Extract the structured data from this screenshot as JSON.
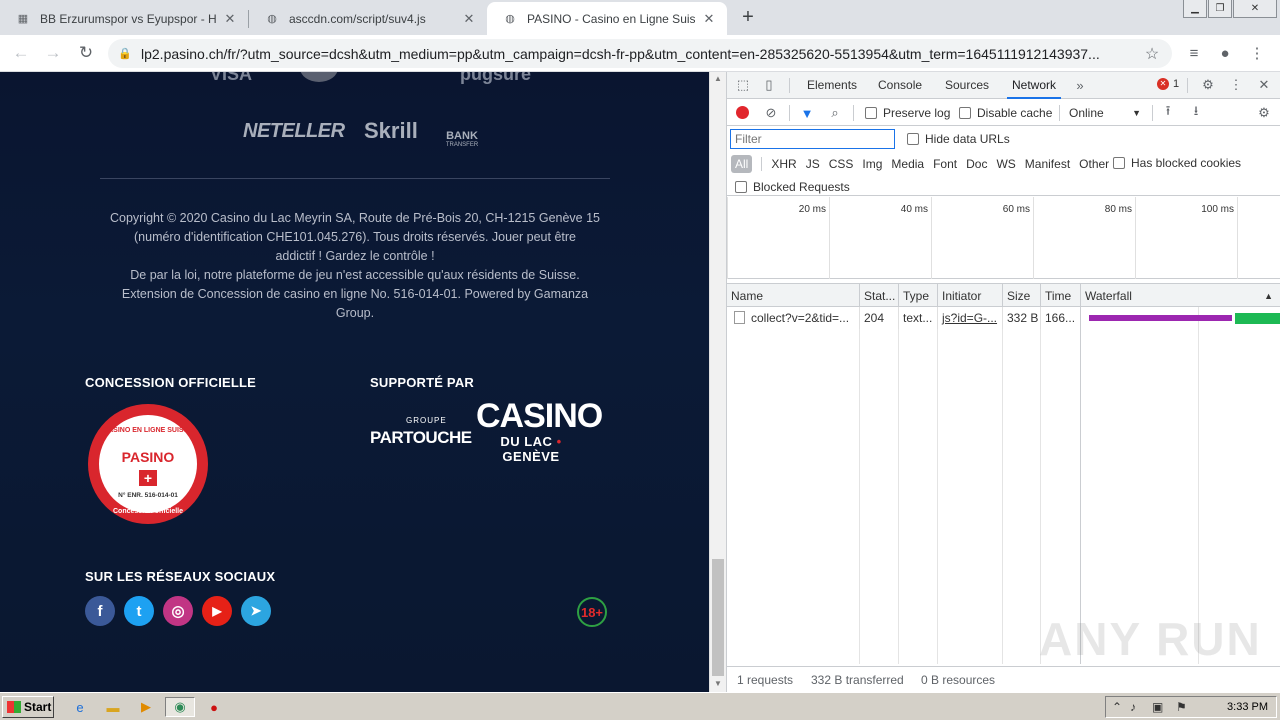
{
  "browser": {
    "tabs": [
      {
        "title": "BB Erzurumspor vs Eyupspor - H",
        "active": false
      },
      {
        "title": "asccdn.com/script/suv4.js",
        "active": false
      },
      {
        "title": "PASINO - Casino en Ligne Suisse - S",
        "active": true
      }
    ],
    "url": "lp2.pasino.ch/fr/?utm_source=dcsh&utm_medium=pp&utm_campaign=dcsh-fr-pp&utm_content=en-285325620-5513954&utm_term=1645111912143937..."
  },
  "page": {
    "payment_top": [
      "VISA",
      "pugsure"
    ],
    "payments": {
      "neteller": "NETELLER",
      "skrill": "Skrill",
      "bank_line1": "BANK",
      "bank_line2": "TRANSFER"
    },
    "copyright_lines": [
      "Copyright © 2020 Casino du Lac Meyrin SA, Route de Pré-Bois 20, CH-1215 Genève 15",
      "(numéro d'identification CHE101.045.276). Tous droits réservés. Jouer peut être",
      "addictif ! Gardez le contrôle !",
      "De par la loi, notre plateforme de jeu n'est accessible qu'aux résidents de Suisse.",
      "Extension de Concession de casino en ligne No. 516-014-01. Powered by Gamanza",
      "Group."
    ],
    "concession_title": "CONCESSION OFFICIELLE",
    "seal": {
      "top": "CASINO EN LIGNE SUISSE",
      "brand": "PASINO",
      "number": "N° ENR. 516-014-01",
      "bottom": "Concession officielle"
    },
    "supported_title": "SUPPORTÉ PAR",
    "partouche": {
      "groupe": "GROUPE",
      "name": "PARTOUCHE"
    },
    "casino_lac": {
      "line1": "CASINO",
      "line2": "DU LAC",
      "line3": "GENÈVE"
    },
    "social_title": "SUR LES RÉSEAUX SOCIAUX",
    "socials": [
      {
        "name": "facebook",
        "glyph": "f",
        "color": "#3b5998"
      },
      {
        "name": "twitter",
        "glyph": "t",
        "color": "#1da1f2"
      },
      {
        "name": "instagram",
        "glyph": "◎",
        "color": "#c13584"
      },
      {
        "name": "youtube",
        "glyph": "▶",
        "color": "#e62117"
      },
      {
        "name": "telegram",
        "glyph": "➤",
        "color": "#2ca5e0"
      }
    ],
    "age_badge": "18+"
  },
  "devtools": {
    "tabs": [
      "Elements",
      "Console",
      "Sources",
      "Network"
    ],
    "active_tab": "Network",
    "error_count": "1",
    "preserve_log": "Preserve log",
    "disable_cache": "Disable cache",
    "throttle": "Online",
    "filter_placeholder": "Filter",
    "hide_data_urls": "Hide data URLs",
    "types": [
      "All",
      "XHR",
      "JS",
      "CSS",
      "Img",
      "Media",
      "Font",
      "Doc",
      "WS",
      "Manifest",
      "Other"
    ],
    "has_blocked_cookies": "Has blocked cookies",
    "blocked_requests": "Blocked Requests",
    "timeline_ticks": [
      "20 ms",
      "40 ms",
      "60 ms",
      "80 ms",
      "100 ms"
    ],
    "columns": [
      "Name",
      "Stat...",
      "Type",
      "Initiator",
      "Size",
      "Time",
      "Waterfall"
    ],
    "rows": [
      {
        "name": "collect?v=2&tid=...",
        "status": "204",
        "type": "text...",
        "initiator": "js?id=G-...",
        "size": "332 B",
        "time": "166..."
      }
    ],
    "status": {
      "requests": "1 requests",
      "transferred": "332 B transferred",
      "resources": "0 B resources"
    },
    "watermark": "ANY RUN"
  },
  "taskbar": {
    "start": "Start",
    "clock": "3:33 PM"
  }
}
